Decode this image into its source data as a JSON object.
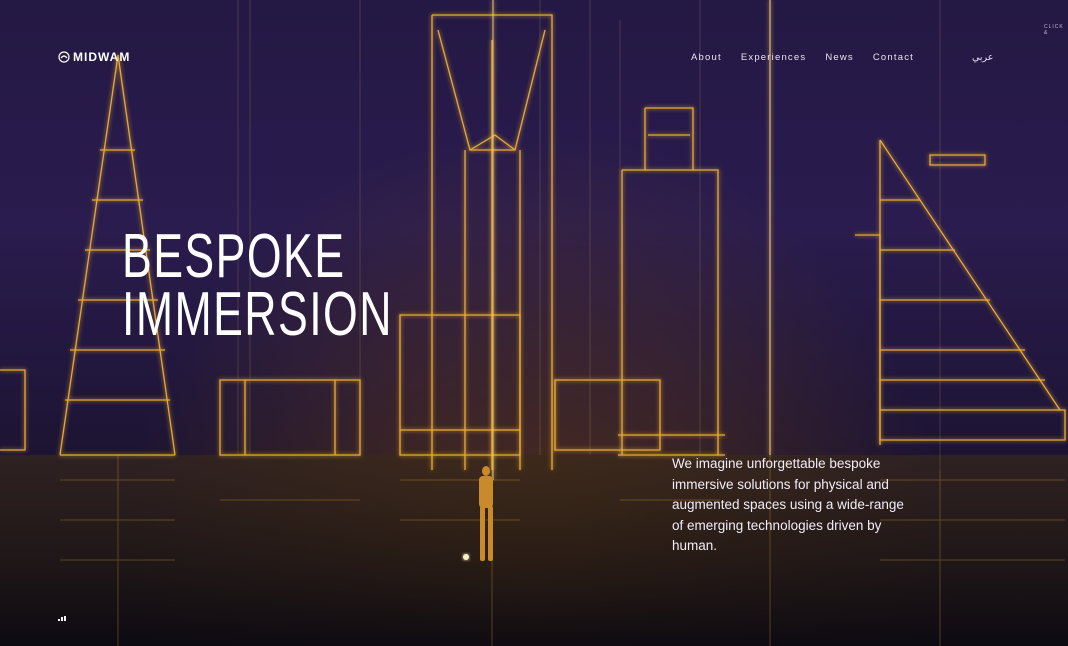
{
  "brand": {
    "name": "MIDWAM"
  },
  "nav": {
    "items": [
      {
        "label": "About"
      },
      {
        "label": "Experiences"
      },
      {
        "label": "News"
      },
      {
        "label": "Contact"
      }
    ],
    "language": "عربي"
  },
  "corner_hint": "CLICK &",
  "hero": {
    "line1": "BESPOKE",
    "line2": "IMMERSION"
  },
  "intro": "We imagine unforgettable bespoke immersive solutions for physical and augmented spaces using a wide-range of emerging technologies driven by human.",
  "colors": {
    "accent": "#f7b733",
    "glow": "#ffd36b",
    "background": "#241844"
  },
  "icons": {
    "logo": "midwam-logo-icon",
    "sound": "sound-bars-icon"
  }
}
